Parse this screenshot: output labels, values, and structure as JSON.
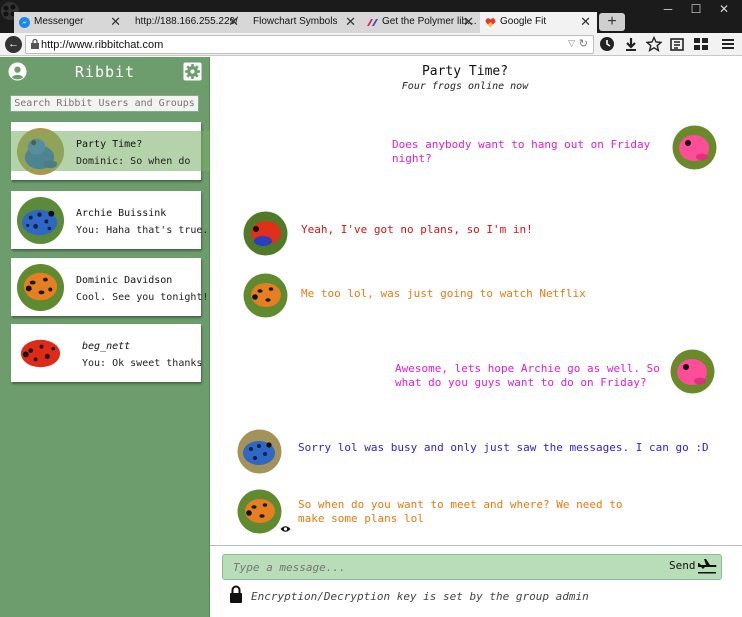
{
  "browser": {
    "tabs": [
      {
        "label": "Messenger",
        "icon": "messenger-icon",
        "color": "#1e88e5"
      },
      {
        "label": "http://188.166.255.229/",
        "icon": "",
        "color": ""
      },
      {
        "label": "Flowchart Symbols",
        "icon": "",
        "color": ""
      },
      {
        "label": "Get the Polymer lib…",
        "icon": "polymer-icon",
        "color": "#e91e63"
      },
      {
        "label": "Google Fit",
        "icon": "google-fit-icon",
        "color": "#e53935"
      }
    ],
    "url": "http://www.ribbitchat.com",
    "new_tab": "+",
    "close_glyph": "✕"
  },
  "sidebar": {
    "title": "Ribbit",
    "search_placeholder": "Search Ribbit Users and Groups",
    "conversations": [
      {
        "name": "Party Time?",
        "preview": "Dominic: So when do",
        "active": true,
        "frog": "blue"
      },
      {
        "name": "Archie Buissink",
        "preview": "You: Haha that's true.",
        "active": false,
        "frog": "blue-spotted"
      },
      {
        "name": "Dominic Davidson",
        "preview": "Cool. See you tonight!",
        "active": false,
        "frog": "orange"
      },
      {
        "name": "beg_nett",
        "preview": "You: Ok sweet thanks",
        "active": false,
        "frog": "red"
      }
    ]
  },
  "chat": {
    "title": "Party Time?",
    "subtitle": "Four frogs online now",
    "messages": [
      {
        "side": "right",
        "text": "Does anybody want to hang out on Friday night?",
        "color": "#e020d0",
        "frog": "pink"
      },
      {
        "side": "left",
        "text": "Yeah, I've got no plans, so I'm in!",
        "color": "#e01010",
        "frog": "red"
      },
      {
        "side": "left",
        "text": "Me too lol, was just going to watch Netflix",
        "color": "#e87a10",
        "frog": "orange"
      },
      {
        "side": "right",
        "text": "Awesome, lets hope Archie go as well. So what do you guys want to do on Friday?",
        "color": "#e020d0",
        "frog": "pink"
      },
      {
        "side": "left",
        "text": "Sorry lol was busy and only just saw the messages. I can go :D",
        "color": "#3020e0",
        "frog": "blue-spotted"
      },
      {
        "side": "left",
        "text": "So when do you want to meet and where? We need to make some plans lol",
        "color": "#e87a10",
        "frog": "orange"
      }
    ],
    "composer": {
      "placeholder": "Type a message...",
      "send_label": "Send"
    },
    "encryption_note": "Encryption/Decryption key is set by the group admin"
  },
  "colors": {
    "sidebar": "#6d9d6d",
    "composer": "#b9ddb9",
    "active_row": "#8fbf7f"
  }
}
